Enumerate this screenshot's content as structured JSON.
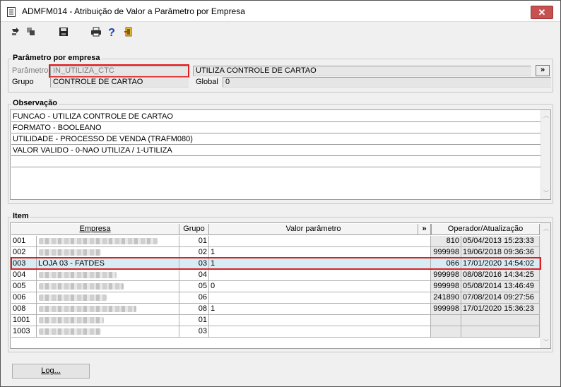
{
  "window": {
    "title": "ADMFM014 - Atribuição de Valor a Parâmetro por Empresa",
    "close_label": "✕"
  },
  "toolbar": {
    "icons": [
      "arrow-in-icon",
      "copy-icon",
      "save-icon",
      "print-icon",
      "help-icon",
      "exit-door-icon"
    ],
    "help_glyph": "?"
  },
  "parametro_group": {
    "legend": "Parâmetro por empresa",
    "parametro_label": "Parâmetro",
    "parametro_value": "IN_UTILIZA_CTC",
    "parametro_desc": "UTILIZA CONTROLE DE CARTAO",
    "lookup_button": "»",
    "grupo_label": "Grupo",
    "grupo_value": "CONTROLE DE CARTAO",
    "global_label": "Global",
    "global_value": "0"
  },
  "observacao_group": {
    "legend": "Observação",
    "lines": [
      "FUNCAO - UTILIZA CONTROLE DE CARTAO",
      "FORMATO - BOOLEANO",
      "UTILIDADE - PROCESSO DE VENDA (TRAFM080)",
      "VALOR VALIDO - 0-NAO UTILIZA / 1-UTILIZA",
      ""
    ]
  },
  "item_group": {
    "legend": "Item",
    "columns": {
      "empresa": "Empresa",
      "grupo": "Grupo",
      "valor": "Valor parâmetro",
      "expand": "»",
      "operador": "Operador/Atualização"
    },
    "rows": [
      {
        "codigo": "001",
        "empresa": "",
        "grupo": "01",
        "valor": "",
        "operador": "810",
        "atualizacao": "05/04/2013 15:23:33"
      },
      {
        "codigo": "002",
        "empresa": "",
        "grupo": "02",
        "valor": "1",
        "operador": "999998",
        "atualizacao": "19/06/2018 09:36:36"
      },
      {
        "codigo": "003",
        "empresa": "LOJA 03 - FATDES",
        "grupo": "03",
        "valor": "1",
        "operador": "066",
        "atualizacao": "17/01/2020 14:54:02"
      },
      {
        "codigo": "004",
        "empresa": "",
        "grupo": "04",
        "valor": "",
        "operador": "999998",
        "atualizacao": "08/08/2016 14:34:25"
      },
      {
        "codigo": "005",
        "empresa": "",
        "grupo": "05",
        "valor": "0",
        "operador": "999998",
        "atualizacao": "05/08/2014 13:46:49"
      },
      {
        "codigo": "006",
        "empresa": "",
        "grupo": "06",
        "valor": "",
        "operador": "241890",
        "atualizacao": "07/08/2014 09:27:56"
      },
      {
        "codigo": "008",
        "empresa": "",
        "grupo": "08",
        "valor": "1",
        "operador": "999998",
        "atualizacao": "17/01/2020 15:36:23"
      },
      {
        "codigo": "1001",
        "empresa": "",
        "grupo": "01",
        "valor": "",
        "operador": "",
        "atualizacao": ""
      },
      {
        "codigo": "1003",
        "empresa": "",
        "grupo": "03",
        "valor": "",
        "operador": "",
        "atualizacao": ""
      }
    ]
  },
  "footer": {
    "log_button": "Log..."
  },
  "colors": {
    "highlight_border": "#e02020",
    "selected_row": "#d6edf5",
    "close_button": "#c75050"
  }
}
